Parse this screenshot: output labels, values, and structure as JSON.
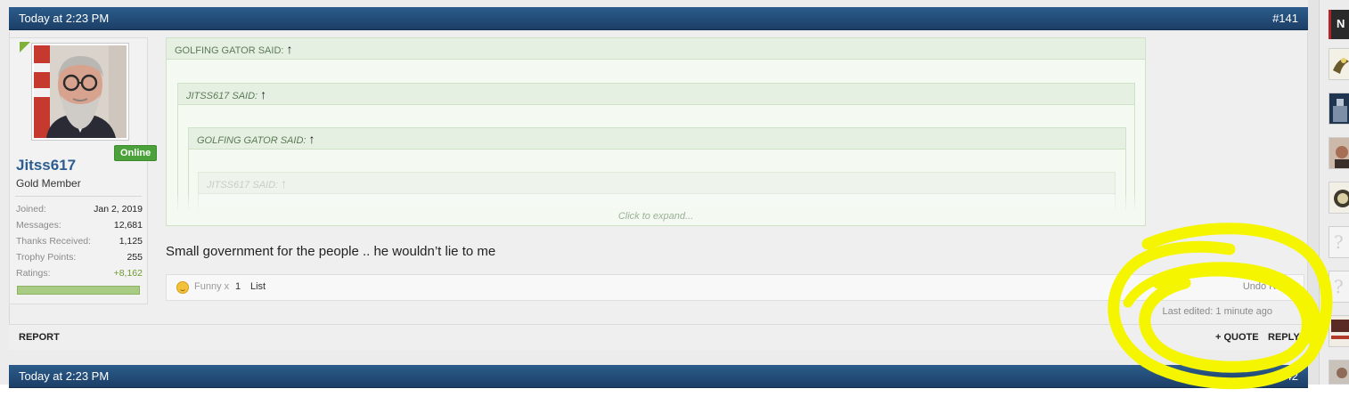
{
  "post": {
    "timestamp": "Today at 2:23 PM",
    "number": "#141",
    "user": {
      "online_badge": "Online",
      "username": "Jitss617",
      "title": "Gold Member",
      "stats": [
        {
          "label": "Joined:",
          "value": "Jan 2, 2019"
        },
        {
          "label": "Messages:",
          "value": "12,681"
        },
        {
          "label": "Thanks Received:",
          "value": "1,125"
        },
        {
          "label": "Trophy Points:",
          "value": "255"
        },
        {
          "label": "Ratings:",
          "value": "+8,162"
        }
      ]
    },
    "quotes": {
      "q1_header": "GOLFING GATOR SAID:",
      "q2_header": "JITSS617 SAID:",
      "q3_header": "GOLFING GATOR SAID:",
      "q4_header": "JITSS617 SAID:",
      "arrow": "↑",
      "expand": "Click to expand..."
    },
    "message": "Small government for the people .. he wouldn’t lie to me",
    "ratings": {
      "rating_name": "Funny x",
      "count": "1",
      "list_label": "List",
      "undo_label": "Undo Rating",
      "icon": "funny-face-icon"
    },
    "last_edited": "Last edited: 1 minute ago",
    "actions": {
      "report": "REPORT",
      "quote": "+ QUOTE",
      "reply": "REPLY"
    }
  },
  "next_post": {
    "timestamp": "Today at 2:23 PM",
    "number": "#142"
  },
  "sidebar": {
    "header_letter": "N"
  },
  "colors": {
    "header_blue": "#2c5c8c",
    "username_blue": "#2b5d90",
    "online_green": "#4ba13a",
    "positive_rating": "#6d9a2f",
    "annotation_yellow": "#f5f500"
  }
}
